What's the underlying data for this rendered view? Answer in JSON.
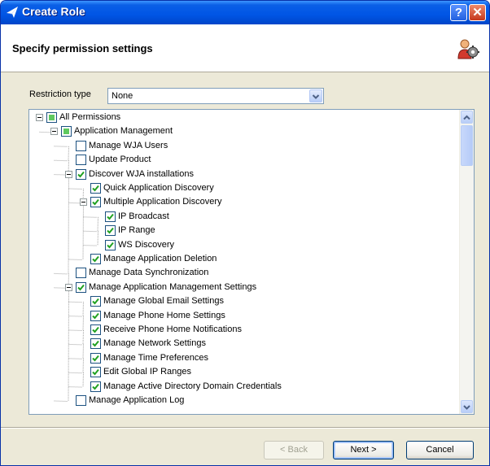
{
  "window": {
    "title": "Create Role",
    "help_label": "?",
    "close_label": "✕"
  },
  "header": {
    "title": "Specify permission settings",
    "icon": "user-gear-icon"
  },
  "restriction": {
    "label": "Restriction type",
    "value": "None"
  },
  "tree": [
    {
      "label": "All Permissions",
      "level": 0,
      "state": "partial",
      "expander": "minus"
    },
    {
      "label": "Application Management",
      "level": 1,
      "state": "partial",
      "expander": "minus"
    },
    {
      "label": "Manage WJA Users",
      "level": 2,
      "state": "unchecked"
    },
    {
      "label": "Update Product",
      "level": 2,
      "state": "unchecked"
    },
    {
      "label": "Discover WJA installations",
      "level": 2,
      "state": "checked",
      "expander": "minus"
    },
    {
      "label": "Quick Application Discovery",
      "level": 3,
      "state": "checked"
    },
    {
      "label": "Multiple Application Discovery",
      "level": 3,
      "state": "checked",
      "expander": "minus"
    },
    {
      "label": "IP Broadcast",
      "level": 4,
      "state": "checked"
    },
    {
      "label": "IP Range",
      "level": 4,
      "state": "checked"
    },
    {
      "label": "WS Discovery",
      "level": 4,
      "state": "checked"
    },
    {
      "label": "Manage Application Deletion",
      "level": 3,
      "state": "checked"
    },
    {
      "label": "Manage Data Synchronization",
      "level": 2,
      "state": "unchecked"
    },
    {
      "label": "Manage Application Management Settings",
      "level": 2,
      "state": "checked",
      "expander": "minus"
    },
    {
      "label": "Manage Global Email Settings",
      "level": 3,
      "state": "checked"
    },
    {
      "label": "Manage Phone Home Settings",
      "level": 3,
      "state": "checked"
    },
    {
      "label": "Receive Phone Home Notifications",
      "level": 3,
      "state": "checked"
    },
    {
      "label": "Manage Network Settings",
      "level": 3,
      "state": "checked"
    },
    {
      "label": "Manage Time Preferences",
      "level": 3,
      "state": "checked"
    },
    {
      "label": "Edit Global IP Ranges",
      "level": 3,
      "state": "checked"
    },
    {
      "label": "Manage Active Directory Domain Credentials",
      "level": 3,
      "state": "checked"
    },
    {
      "label": "Manage Application Log",
      "level": 2,
      "state": "unchecked"
    }
  ],
  "buttons": {
    "back": "< Back",
    "next": "Next >",
    "cancel": "Cancel"
  },
  "colors": {
    "titlebar": "#0055e5",
    "check": "#21a121",
    "partial": "#5fc95f",
    "checkbox_border": "#1c5180"
  }
}
